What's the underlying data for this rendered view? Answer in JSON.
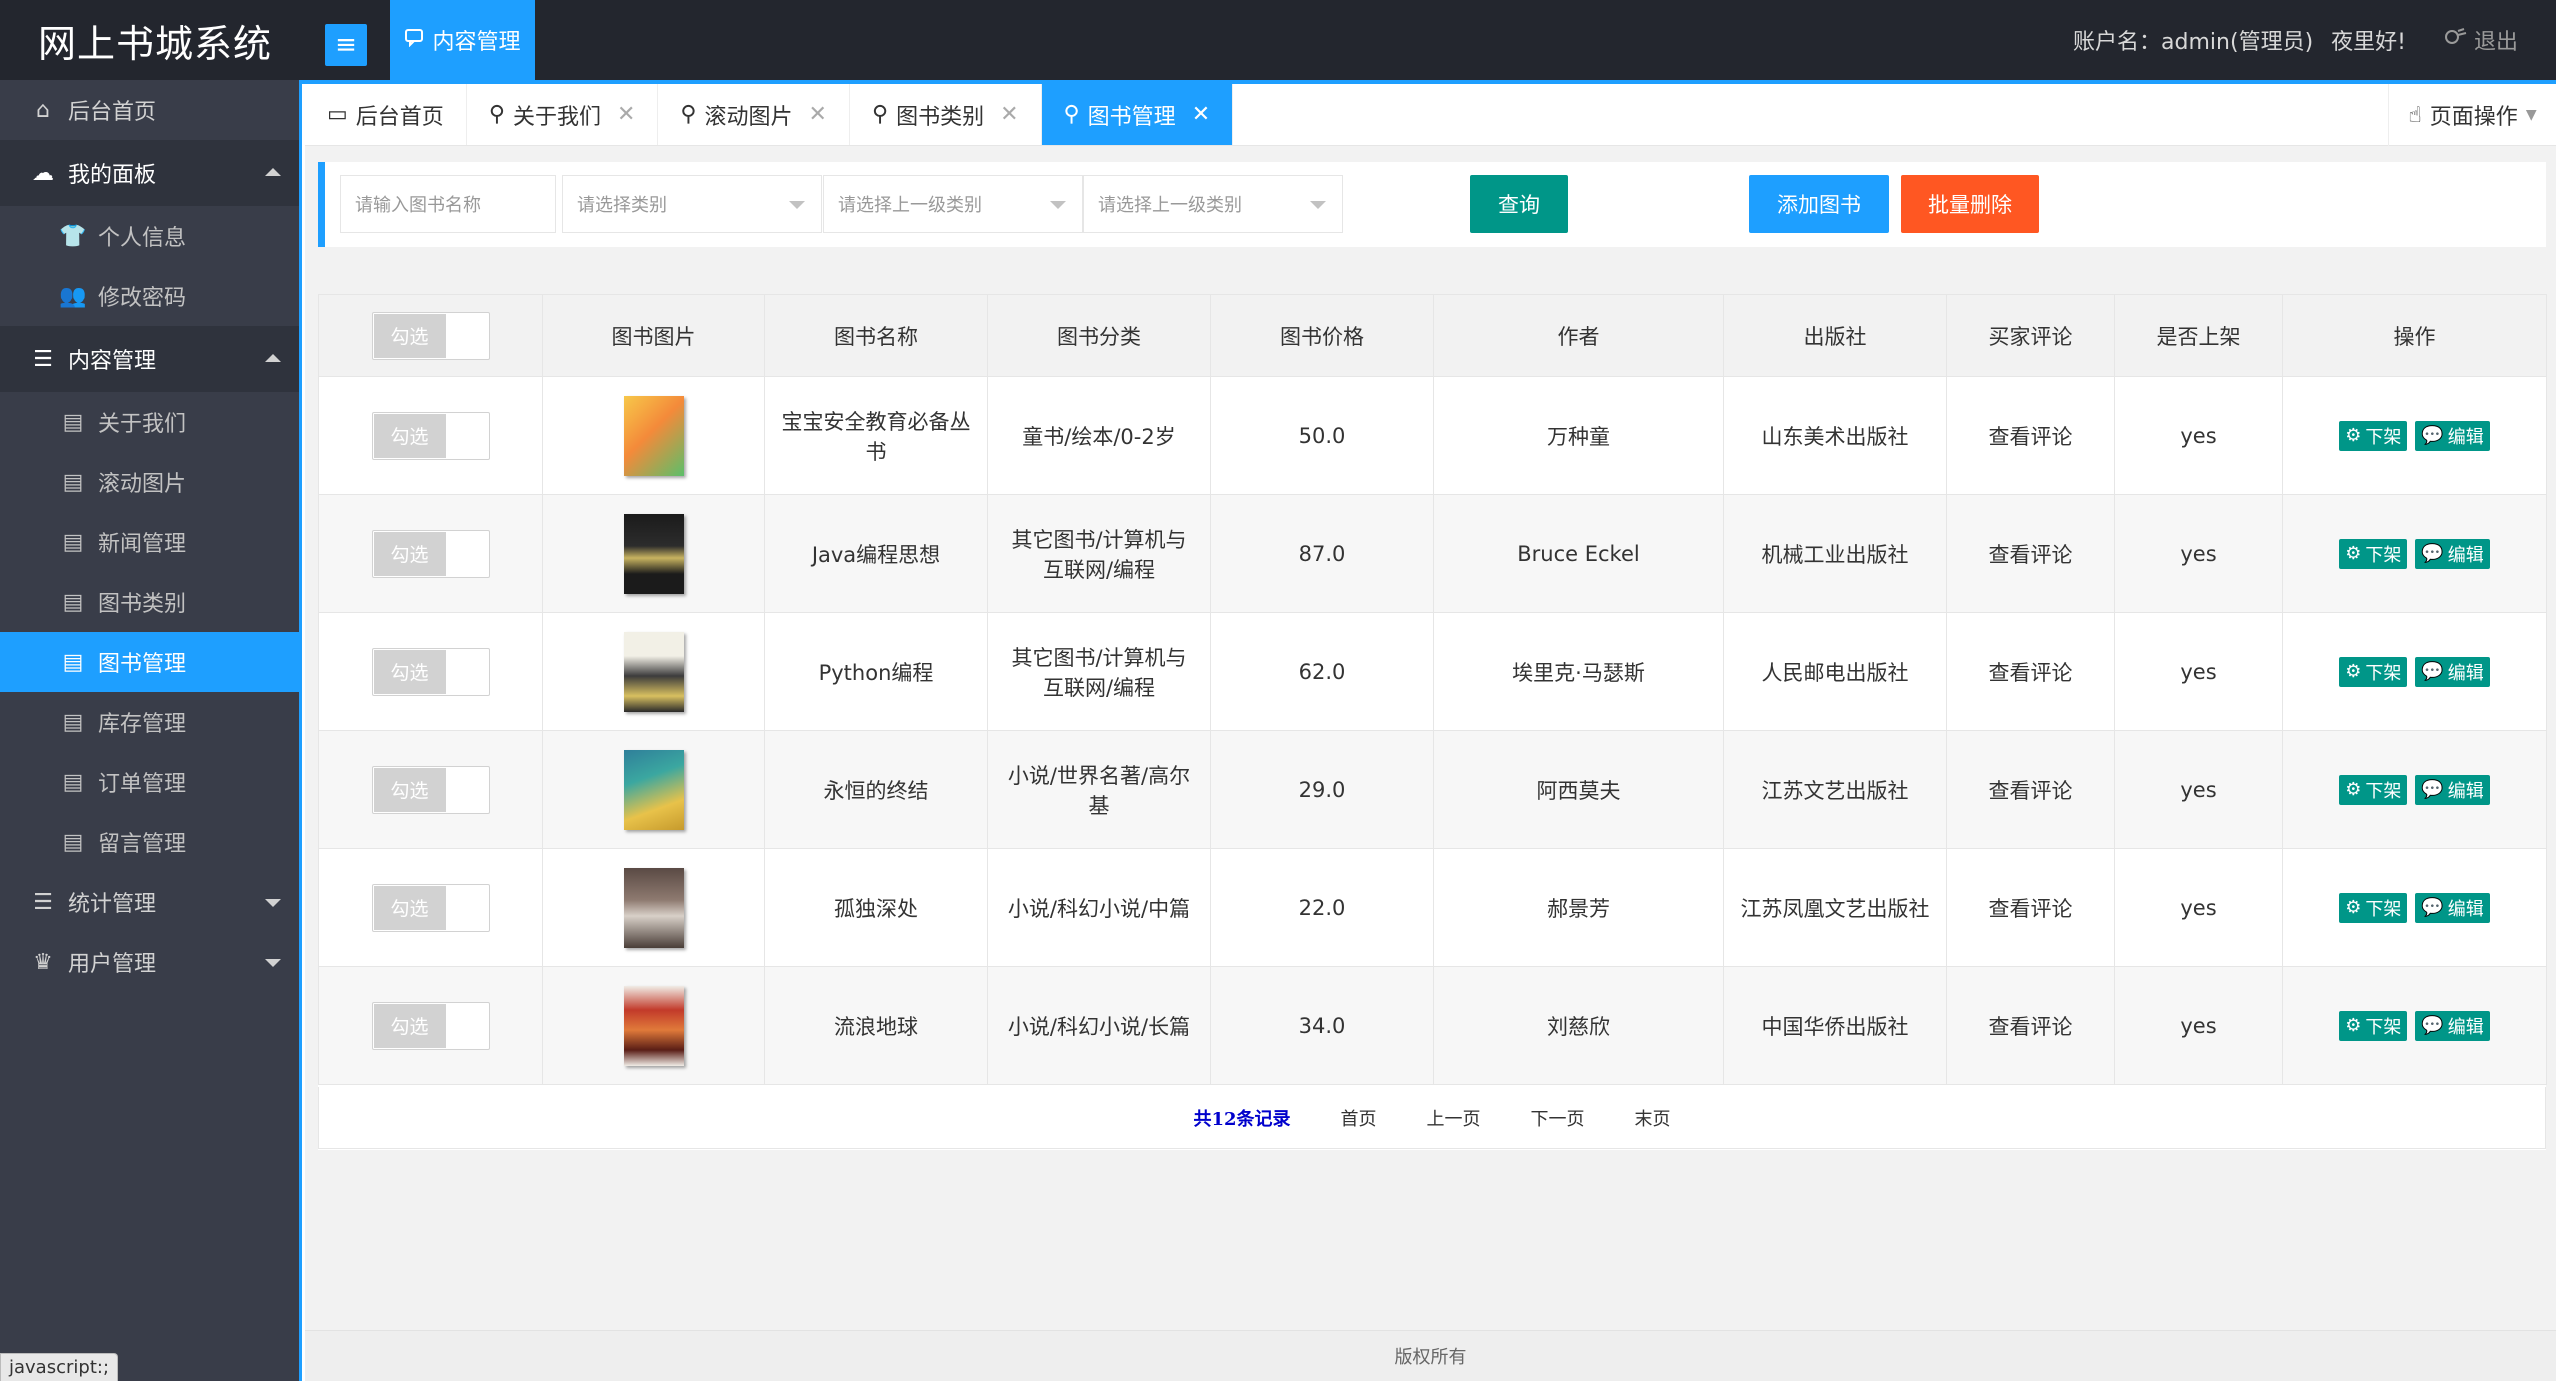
{
  "header": {
    "brand": "网上书城系统",
    "menu_toggle_icon": "≡",
    "top_tab": "内容管理",
    "account": "账户名：admin(管理员)",
    "greeting": "夜里好!",
    "logout": "退出"
  },
  "sidebar": {
    "home": "后台首页",
    "panel_group": "我的面板",
    "panel_items": [
      "个人信息",
      "修改密码"
    ],
    "content_group": "内容管理",
    "content_items": [
      "关于我们",
      "滚动图片",
      "新闻管理",
      "图书类别",
      "图书管理",
      "库存管理",
      "订单管理",
      "留言管理"
    ],
    "stats_group": "统计管理",
    "users_group": "用户管理",
    "status_bar": "javascript:;"
  },
  "tabs": {
    "items": [
      "后台首页",
      "关于我们",
      "滚动图片",
      "图书类别",
      "图书管理"
    ],
    "active": "图书管理",
    "page_ops": "页面操作"
  },
  "search": {
    "name_placeholder": "请输入图书名称",
    "category_placeholder": "请选择类别",
    "parent1_placeholder": "请选择上一级类别",
    "parent2_placeholder": "请选择上一级类别",
    "query_label": "查询",
    "add_label": "添加图书",
    "batch_delete_label": "批量删除"
  },
  "colors": {
    "accent": "#1e9fff",
    "query": "#009688",
    "add": "#1e9fff",
    "delete": "#ff5722",
    "sidebar": "#393d49",
    "header": "#23262e"
  },
  "table": {
    "headers": [
      "勾选",
      "图书图片",
      "图书名称",
      "图书分类",
      "图书价格",
      "作者",
      "出版社",
      "买家评论",
      "是否上架",
      "操作"
    ],
    "check_label": "勾选",
    "rows": [
      {
        "name": "宝宝安全教育必备丛书",
        "category": "童书/绘本/0-2岁",
        "price": "50.0",
        "author": "万种童",
        "publisher": "山东美术出版社",
        "review": "查看评论",
        "listed": "yes"
      },
      {
        "name": "Java编程思想",
        "category": "其它图书/计算机与互联网/编程",
        "price": "87.0",
        "author": "Bruce Eckel",
        "publisher": "机械工业出版社",
        "review": "查看评论",
        "listed": "yes"
      },
      {
        "name": "Python编程",
        "category": "其它图书/计算机与互联网/编程",
        "price": "62.0",
        "author": "埃里克·马瑟斯",
        "publisher": "人民邮电出版社",
        "review": "查看评论",
        "listed": "yes"
      },
      {
        "name": "永恒的终结",
        "category": "小说/世界名著/高尔基",
        "price": "29.0",
        "author": "阿西莫夫",
        "publisher": "江苏文艺出版社",
        "review": "查看评论",
        "listed": "yes"
      },
      {
        "name": "孤独深处",
        "category": "小说/科幻小说/中篇",
        "price": "22.0",
        "author": "郝景芳",
        "publisher": "江苏凤凰文艺出版社",
        "review": "查看评论",
        "listed": "yes"
      },
      {
        "name": "流浪地球",
        "category": "小说/科幻小说/长篇",
        "price": "34.0",
        "author": "刘慈欣",
        "publisher": "中国华侨出版社",
        "review": "查看评论",
        "listed": "yes"
      }
    ],
    "action_off": "下架",
    "action_edit": "编辑"
  },
  "pager": {
    "total": "共12条记录",
    "first": "首页",
    "prev": "上一页",
    "next": "下一页",
    "last": "末页"
  },
  "footer": "版权所有"
}
